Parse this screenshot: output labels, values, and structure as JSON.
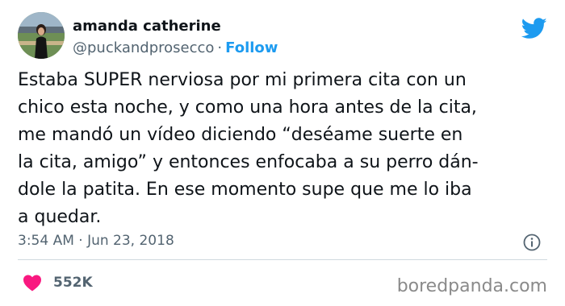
{
  "user": {
    "name": "amanda catherine",
    "handle": "@puckandprosecco",
    "separator": "·",
    "follow_label": "Follow"
  },
  "tweet": {
    "lines": [
      "Estaba SUPER nerviosa por mi primera cita con un",
      "chico esta noche, y como una hora antes de la cita,",
      "me mandó un vídeo diciendo “deséame suerte en",
      "la cita, amigo” y entonces enfocaba a su perro dán-",
      "dole la patita. En ese momento supe que me lo iba",
      "a quedar."
    ],
    "timestamp": "3:54 AM · Jun 23, 2018",
    "like_count": "552K"
  },
  "icons": {
    "brand": "twitter-bird-icon",
    "info": "info-icon",
    "like": "heart-icon"
  },
  "colors": {
    "accent": "#1d9bf0",
    "heart": "#f91880",
    "text": "#0f1419",
    "muted": "#536471"
  },
  "watermark": "boredpanda.com"
}
